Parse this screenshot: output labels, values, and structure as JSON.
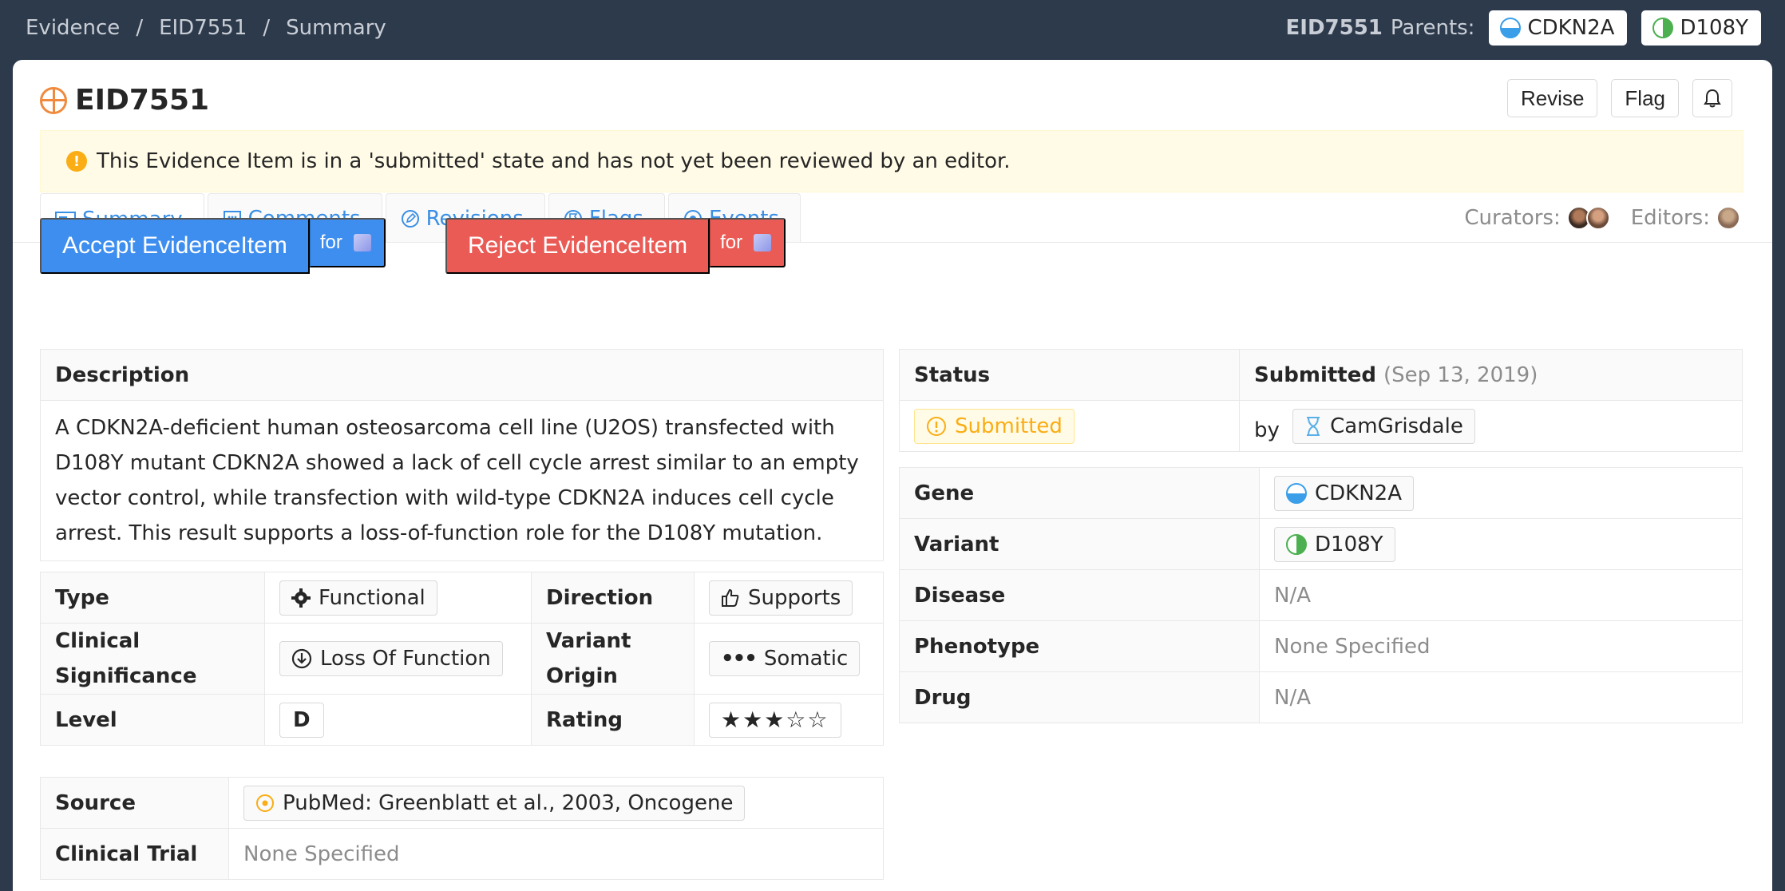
{
  "breadcrumb": {
    "items": [
      "Evidence",
      "EID7551",
      "Summary"
    ],
    "sep": "/"
  },
  "parents": {
    "eid": "EID7551",
    "label": "Parents:",
    "gene": "CDKN2A",
    "variant": "D108Y"
  },
  "header": {
    "title": "EID7551",
    "revise": "Revise",
    "flag": "Flag"
  },
  "alert": {
    "text": "This Evidence Item is in a 'submitted' state and has not yet been reviewed by an editor."
  },
  "tabs": [
    "Summary",
    "Comments",
    "Revisions",
    "Flags",
    "Events"
  ],
  "people": {
    "curators_label": "Curators:",
    "editors_label": "Editors:"
  },
  "actions": {
    "accept": "Accept EvidenceItem",
    "reject": "Reject EvidenceItem",
    "for": "for"
  },
  "description": {
    "label": "Description",
    "text": "A CDKN2A-deficient human osteosarcoma cell line (U2OS) transfected with D108Y mutant CDKN2A showed a lack of cell cycle arrest similar to an empty vector control, while transfection with wild-type CDKN2A induces cell cycle arrest. This result supports a loss-of-function role for the D108Y mutation."
  },
  "attributes": {
    "type_label": "Type",
    "type_value": "Functional",
    "direction_label": "Direction",
    "direction_value": "Supports",
    "clinsig_label": "Clinical Significance",
    "clinsig_value": "Loss Of Function",
    "origin_label": "Variant Origin",
    "origin_value": "Somatic",
    "level_label": "Level",
    "level_value": "D",
    "rating_label": "Rating",
    "rating_value": 3,
    "rating_max": 5,
    "rating_stars": "★★★☆☆"
  },
  "source": {
    "source_label": "Source",
    "source_value": "PubMed: Greenblatt et al., 2003, Oncogene",
    "trial_label": "Clinical Trial",
    "trial_value": "None Specified"
  },
  "status": {
    "label": "Status",
    "state": "Submitted",
    "date": "(Sep 13, 2019)",
    "badge": "Submitted",
    "by": "by",
    "user": "CamGrisdale"
  },
  "entities": {
    "gene_label": "Gene",
    "gene_value": "CDKN2A",
    "variant_label": "Variant",
    "variant_value": "D108Y",
    "disease_label": "Disease",
    "disease_value": "N/A",
    "phenotype_label": "Phenotype",
    "phenotype_value": "None Specified",
    "drug_label": "Drug",
    "drug_value": "N/A"
  },
  "colors": {
    "accent": "#3a8fe5",
    "accept": "#3e8ef0",
    "reject": "#ea5b55",
    "warning": "#faad14",
    "topbar": "#2d3a4b"
  }
}
